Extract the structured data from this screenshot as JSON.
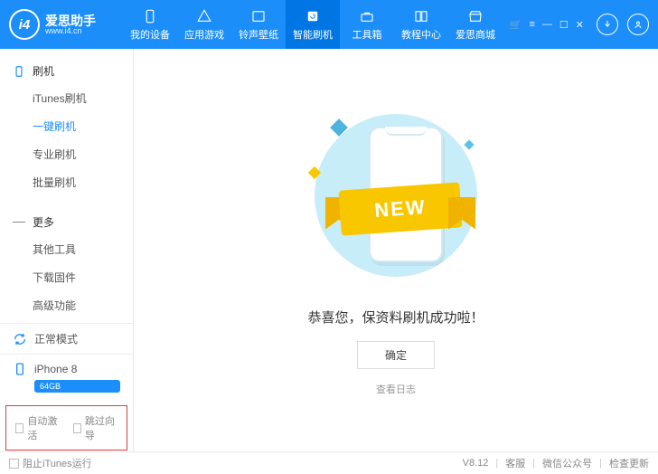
{
  "logo": {
    "badge": "i4",
    "cn": "爱思助手",
    "url": "www.i4.cn"
  },
  "tabs": [
    {
      "key": "device",
      "label": "我的设备"
    },
    {
      "key": "games",
      "label": "应用游戏"
    },
    {
      "key": "ringtone",
      "label": "铃声壁纸"
    },
    {
      "key": "flash",
      "label": "智能刷机"
    },
    {
      "key": "toolbox",
      "label": "工具箱"
    },
    {
      "key": "tutorial",
      "label": "教程中心"
    },
    {
      "key": "store",
      "label": "爱思商城"
    }
  ],
  "sidebar": {
    "section1": {
      "title": "刷机",
      "items": [
        "iTunes刷机",
        "一键刷机",
        "专业刷机",
        "批量刷机"
      ]
    },
    "section2": {
      "title": "更多",
      "items": [
        "其他工具",
        "下载固件",
        "高级功能"
      ]
    }
  },
  "mode": {
    "label": "正常模式"
  },
  "device": {
    "name": "iPhone 8",
    "capacity": "64GB"
  },
  "options": {
    "auto_activate": "自动激活",
    "skip_guide": "跳过向导"
  },
  "content": {
    "ribbon": "NEW",
    "success": "恭喜您，保资料刷机成功啦！",
    "ok": "确定",
    "log": "查看日志"
  },
  "footer": {
    "block_itunes": "阻止iTunes运行",
    "version": "V8.12",
    "support": "客服",
    "wechat": "微信公众号",
    "update": "检查更新"
  }
}
